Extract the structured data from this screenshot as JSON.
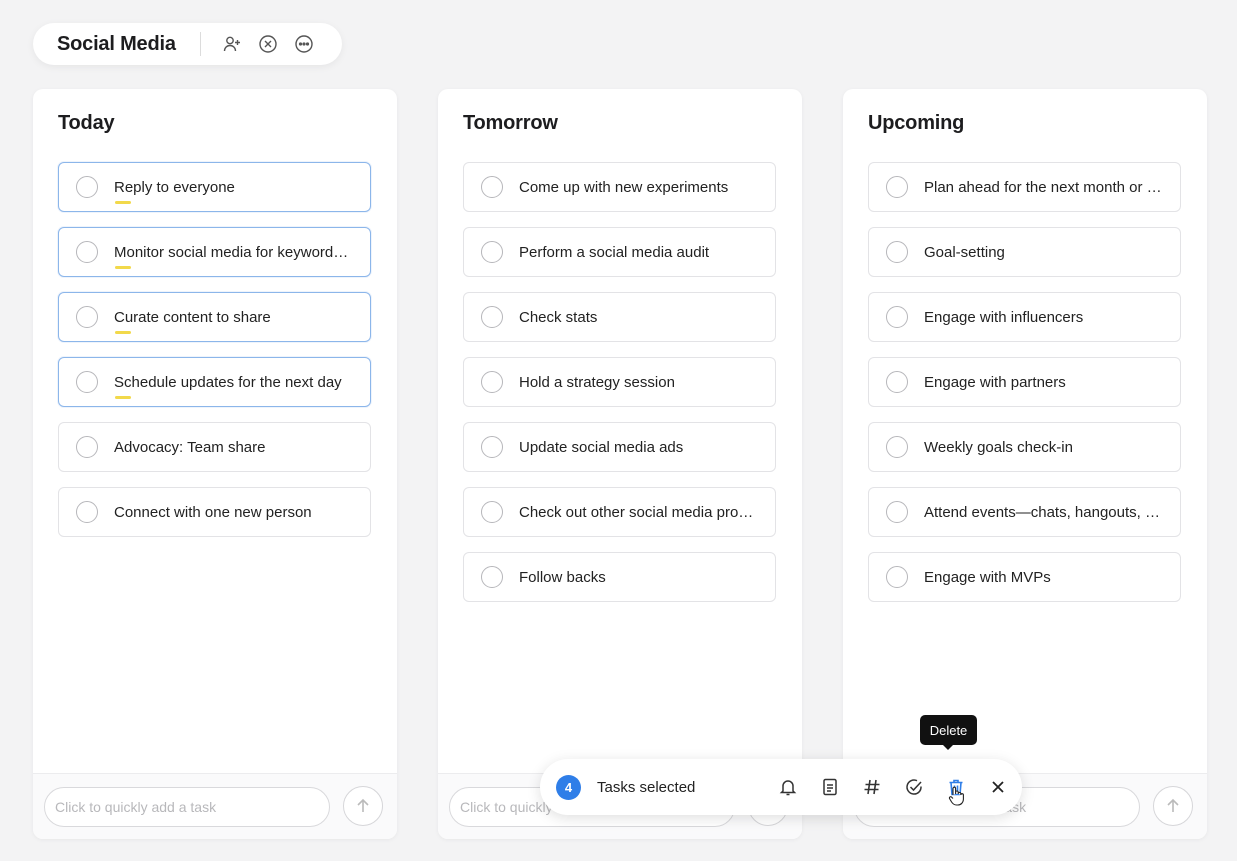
{
  "header": {
    "title": "Social Media",
    "icons": [
      "add-person-icon",
      "close-circle-icon",
      "more-circle-icon"
    ]
  },
  "columns": [
    {
      "title": "Today",
      "tasks": [
        {
          "label": "Reply to everyone",
          "selected": true
        },
        {
          "label": "Monitor social media for keyword…",
          "selected": true
        },
        {
          "label": "Curate content to share",
          "selected": true
        },
        {
          "label": "Schedule updates for the next day",
          "selected": true
        },
        {
          "label": "Advocacy: Team share",
          "selected": false
        },
        {
          "label": "Connect with one new person",
          "selected": false
        }
      ],
      "quick_add_placeholder": "Click to quickly add a task"
    },
    {
      "title": "Tomorrow",
      "tasks": [
        {
          "label": "Come up with new experiments",
          "selected": false
        },
        {
          "label": "Perform a social media audit",
          "selected": false
        },
        {
          "label": "Check stats",
          "selected": false
        },
        {
          "label": "Hold a strategy session",
          "selected": false
        },
        {
          "label": "Update social media ads",
          "selected": false
        },
        {
          "label": "Check out other social media pro…",
          "selected": false
        },
        {
          "label": "Follow backs",
          "selected": false
        }
      ],
      "quick_add_placeholder": "Click to quickly add a task"
    },
    {
      "title": "Upcoming",
      "tasks": [
        {
          "label": "Plan ahead for the next month or …",
          "selected": false
        },
        {
          "label": "Goal-setting",
          "selected": false
        },
        {
          "label": "Engage with influencers",
          "selected": false
        },
        {
          "label": "Engage with partners",
          "selected": false
        },
        {
          "label": "Weekly goals check-in",
          "selected": false
        },
        {
          "label": "Attend events—chats, hangouts, …",
          "selected": false
        },
        {
          "label": "Engage with MVPs",
          "selected": false
        }
      ],
      "quick_add_placeholder": "Click to quickly add a task"
    }
  ],
  "selection_toolbar": {
    "count": "4",
    "label": "Tasks selected",
    "tools": [
      "bell-icon",
      "note-icon",
      "hashtag-icon",
      "check-circle-icon",
      "trash-icon",
      "close-icon"
    ],
    "tooltip": "Delete"
  },
  "colors": {
    "accent": "#2f7ee8",
    "selected_border": "#8cb6ea",
    "mark": "#f2d94b"
  }
}
